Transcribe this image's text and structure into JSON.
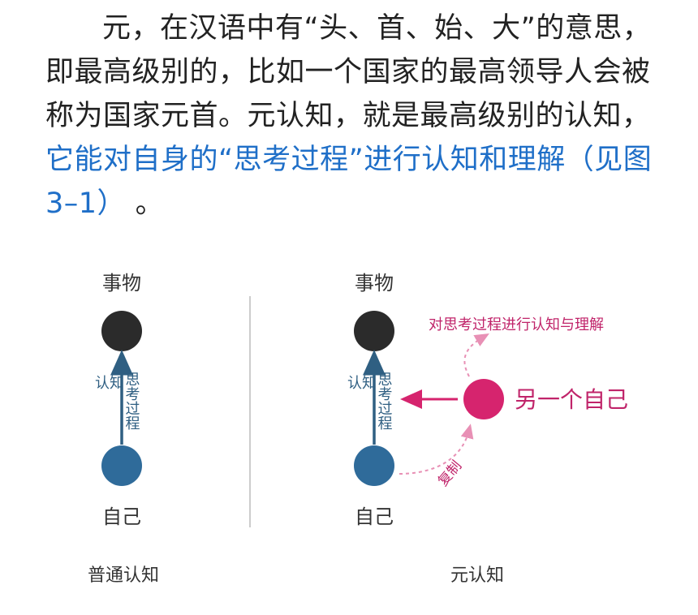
{
  "paragraph": {
    "line1": "元，在汉语中有“头、首、始、大”的意思，",
    "line2": "即最高级别的，比如一个国家的最高领导人会被",
    "line3": "称为国家元首。元认知，就是最高级别的认知，",
    "line4_link": "它能对自身的“思考过程”进行认知和理解（见图",
    "line5_link": "3–1）",
    "line5_tail": " 。"
  },
  "figure": {
    "left": {
      "top_node_label": "事物",
      "bottom_node_label": "自己",
      "arrow_side_label": "认知",
      "arrow_process_label": "思考过程",
      "caption": "普通认知"
    },
    "right": {
      "top_node_label": "事物",
      "bottom_node_label": "自己",
      "arrow_side_label": "认知",
      "arrow_process_label": "思考过程",
      "other_self_label": "另一个自己",
      "reflect_label": "对思考过程进行认知与理解",
      "copy_label": "复制",
      "caption": "元认知"
    },
    "colors": {
      "thing_node": "#2b2b2b",
      "self_node": "#2f6b9a",
      "other_self_node": "#d6246e",
      "arrow": "#2f5f82",
      "pink_text": "#c0246a",
      "caption": "#333333",
      "divider": "#bbbbbb"
    }
  }
}
